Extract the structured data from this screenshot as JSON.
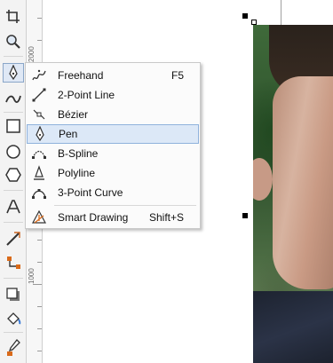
{
  "toolbox": {
    "tools": [
      "crop-icon",
      "zoom-icon",
      "pen-tool-icon",
      "curve-icon",
      "rectangle-icon",
      "ellipse-icon",
      "polygon-icon",
      "text-icon",
      "dimension-icon",
      "connector-icon",
      "drop-shadow-icon",
      "fill-icon",
      "eyedropper-icon"
    ]
  },
  "ruler": {
    "labels": [
      "2000",
      "1000"
    ]
  },
  "menu": {
    "items": [
      {
        "label": "Freehand",
        "shortcut": "F5",
        "icon": "freehand-icon"
      },
      {
        "label": "2-Point Line",
        "shortcut": "",
        "icon": "two-point-line-icon"
      },
      {
        "label": "Bézier",
        "shortcut": "",
        "icon": "bezier-icon"
      },
      {
        "label": "Pen",
        "shortcut": "",
        "icon": "pen-icon",
        "selected": true
      },
      {
        "label": "B-Spline",
        "shortcut": "",
        "icon": "b-spline-icon"
      },
      {
        "label": "Polyline",
        "shortcut": "",
        "icon": "polyline-icon"
      },
      {
        "label": "3-Point Curve",
        "shortcut": "",
        "icon": "three-point-curve-icon"
      },
      {
        "label": "Smart Drawing",
        "shortcut": "Shift+S",
        "icon": "smart-drawing-icon"
      }
    ]
  }
}
